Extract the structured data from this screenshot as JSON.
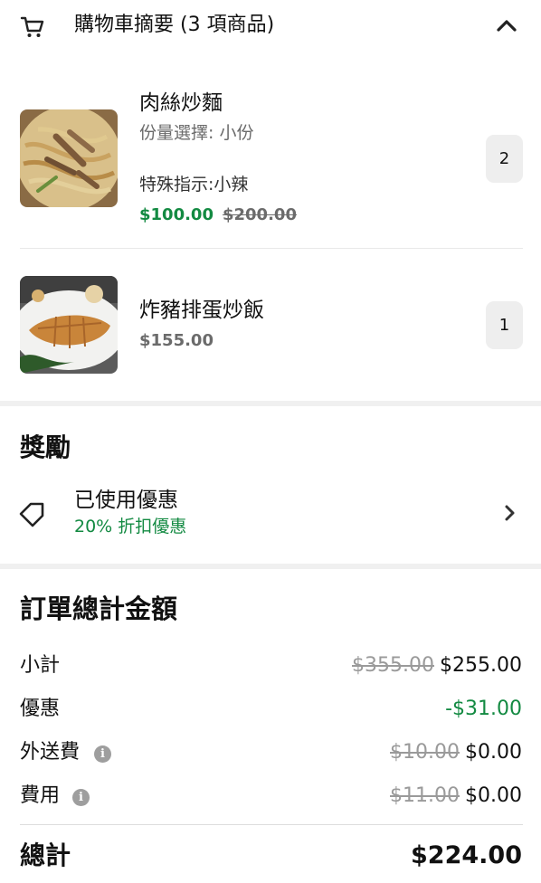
{
  "cart_header": {
    "title": "購物車摘要 (3 項商品)"
  },
  "items": [
    {
      "name": "肉絲炒麵",
      "option": "份量選擇: 小份",
      "instructions": "特殊指示:小辣",
      "price": "$100.00",
      "original_price": "$200.00",
      "quantity": "2"
    },
    {
      "name": "炸豬排蛋炒飯",
      "price": "$155.00",
      "quantity": "1"
    }
  ],
  "rewards": {
    "title": "獎勵",
    "promo_label": "已使用優惠",
    "promo_detail": "20% 折扣優惠"
  },
  "totals": {
    "title": "訂單總計金額",
    "subtotal": {
      "label": "小計",
      "original": "$355.00",
      "value": "$255.00"
    },
    "discount": {
      "label": "優惠",
      "value": "-$31.00"
    },
    "delivery": {
      "label": "外送費",
      "original": "$10.00",
      "value": "$0.00"
    },
    "fees": {
      "label": "費用",
      "original": "$11.00",
      "value": "$0.00"
    },
    "grand": {
      "label": "總計",
      "value": "$224.00"
    }
  },
  "icons": {
    "cart": "shopping-cart-icon",
    "collapse": "chevron-up-icon",
    "tag": "tag-icon",
    "chevron": "chevron-right-icon",
    "info": "info-icon"
  },
  "colors": {
    "accent_green": "#138a42",
    "muted": "#6b6b6b",
    "strike": "#9a9a9a"
  }
}
